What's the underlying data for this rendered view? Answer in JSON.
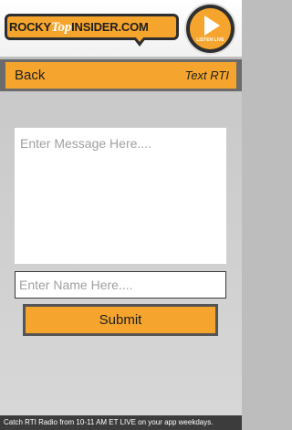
{
  "header": {
    "logo_left": "ROCKY",
    "logo_mid": "Top",
    "logo_right": "INSIDER.COM",
    "listen_label": "LISTEN LIVE",
    "listen_icon": "play-icon"
  },
  "nav": {
    "back_label": "Back",
    "title": "Text RTI"
  },
  "form": {
    "message_placeholder": "Enter Message Here....",
    "name_placeholder": "Enter Name Here....",
    "submit_label": "Submit"
  },
  "ticker": {
    "text": "Catch RTI Radio from 10-11 AM ET LIVE on your app weekdays."
  },
  "colors": {
    "accent": "#f5a52d",
    "dark": "#2e2e2e",
    "background": "#c9c9c9"
  }
}
